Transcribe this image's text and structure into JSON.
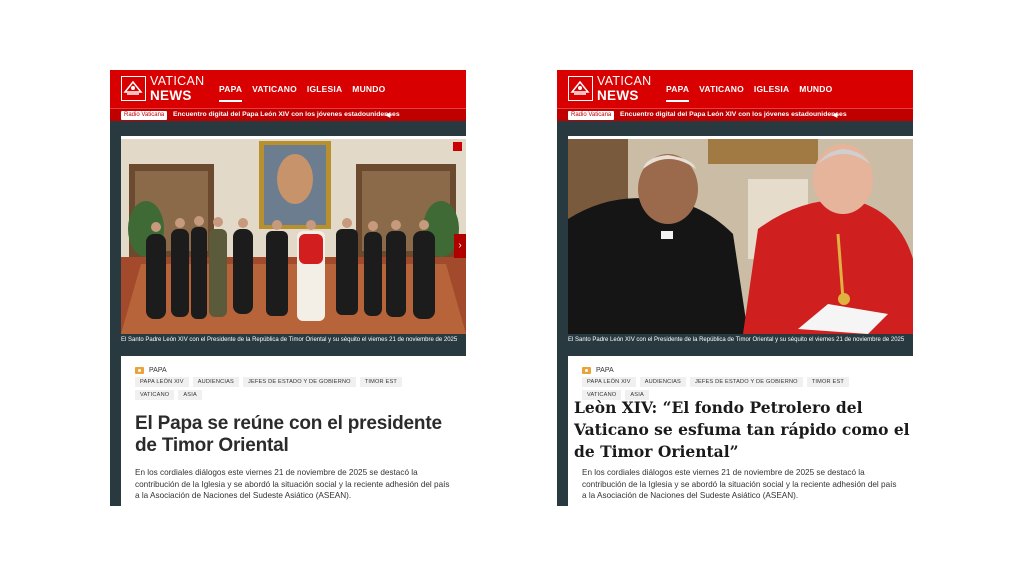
{
  "brand": {
    "line1": "VATICAN",
    "line2": "NEWS"
  },
  "nav": {
    "papa": "PAPA",
    "vaticano": "VATICANO",
    "iglesia": "IGLESIA",
    "mundo": "MUNDO"
  },
  "ticker": {
    "radio": "Radio Vaticana",
    "text": "Encuentro digital del Papa León XIV con los jóvenes estadounidenses",
    "speaker": "◀"
  },
  "caption": "El Santo Padre León XIV con el Presidente de la República de Timor Oriental y su séquito el viernes 21 de noviembre de 2025",
  "section": "PAPA",
  "tags": [
    "PAPA LEÓN XIV",
    "AUDIENCIAS",
    "JEFES DE ESTADO Y DE GOBIERNO",
    "TIMOR EST",
    "VATICANO",
    "ASIA"
  ],
  "left_article": {
    "headline": "El Papa se reúne con el presidente de Timor Oriental"
  },
  "right_article": {
    "headline": "Leòn XIV: “El fondo Petrolero del Vaticano se esfuma tan rápido como el de Timor Oriental”"
  },
  "summary": "En los cordiales diálogos este viernes 21 de noviembre de 2025 se destacó la contribución de la Iglesia y se abordó la situación social y la reciente adhesión del país a la Asociación de Naciones del Sudeste Asiático (ASEAN).",
  "colors": {
    "brand_red": "#d80000",
    "dark_strip": "#283a40"
  }
}
